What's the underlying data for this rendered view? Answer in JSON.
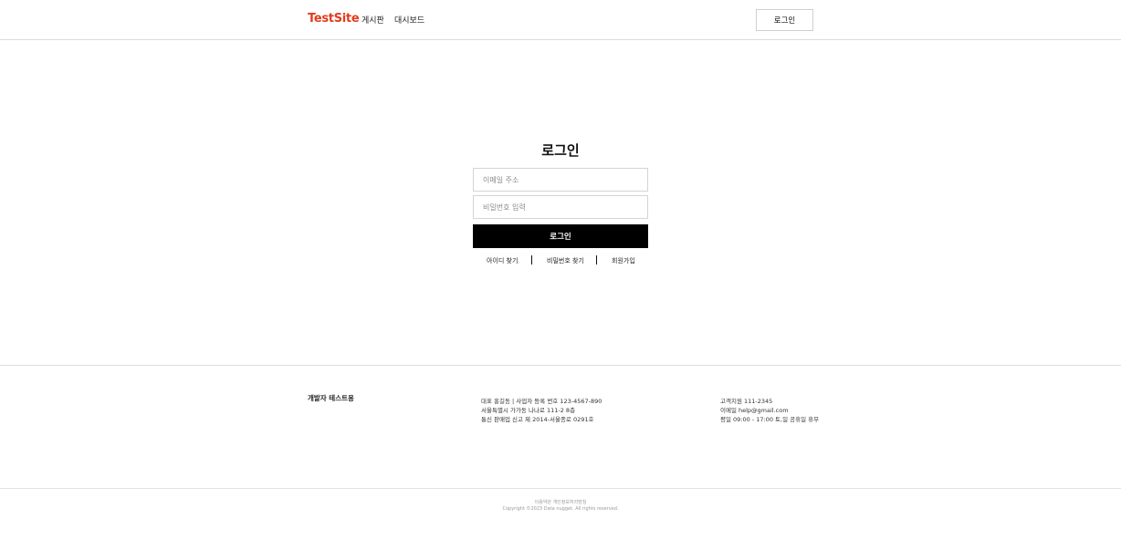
{
  "header": {
    "logo": "TestSite",
    "nav": [
      "게시판",
      "대시보드"
    ],
    "login_button": "로그인"
  },
  "login": {
    "title": "로그인",
    "email_placeholder": "이메일 주소",
    "password_placeholder": "비밀번호 입력",
    "submit_label": "로그인",
    "links": [
      "아이디 찾기",
      "비밀번호 찾기",
      "회원가입"
    ]
  },
  "footer": {
    "brand": "개발자 테스트용",
    "company_lines": [
      "대표 홍길동  |  사업자 등록 번호 123-4567-890",
      "서울특별시 가가동 나나로 111-2 8층",
      "통신 판매업 신고 제 2014-서울종로 0291호"
    ],
    "support_lines": [
      "고객지원 111-2345",
      "이메일 help@gmail.com",
      "평일 09:00 - 17:00 토,일 공휴일 휴무"
    ],
    "legal_links": "이용약관 개인정보처리방침",
    "copyright": "Copyright ©2023 Data nugget. All rights reserved."
  },
  "colors": {
    "brand": "#e43b1e",
    "primary_button": "#000000"
  }
}
